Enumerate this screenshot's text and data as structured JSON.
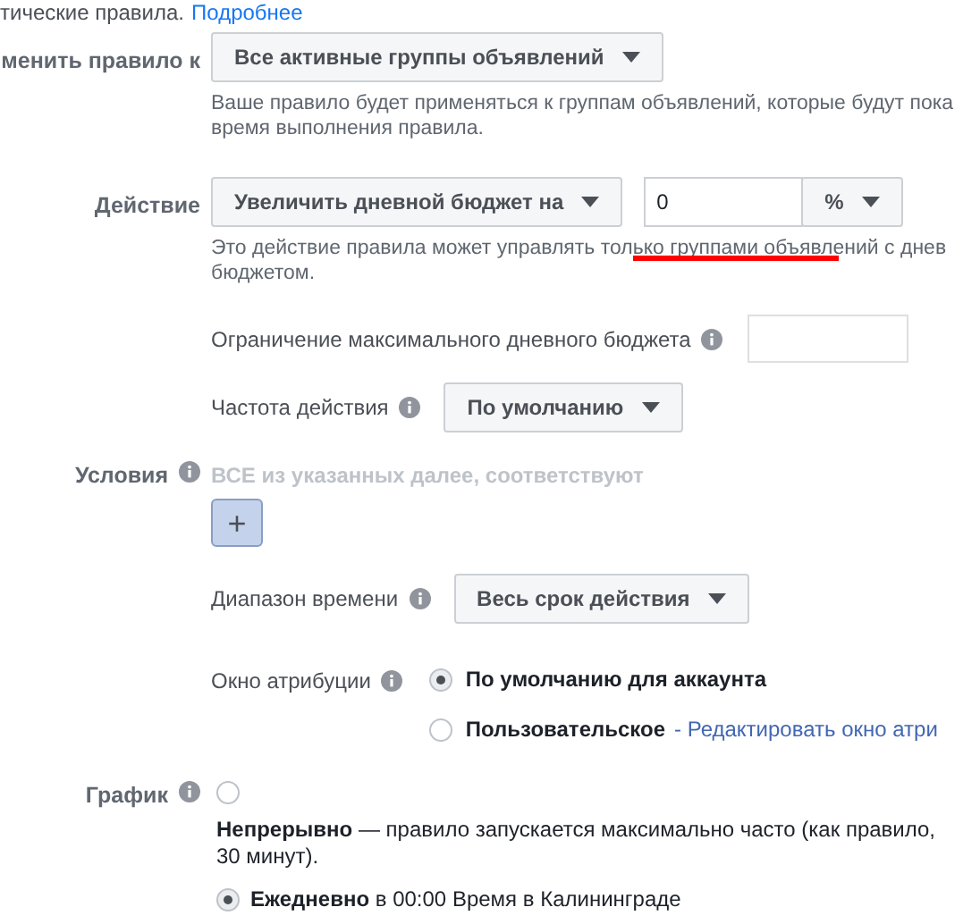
{
  "intro": {
    "text": "тические правила.",
    "link": "Подробнее"
  },
  "apply_to": {
    "label": "менить правило к",
    "select": "Все активные группы объявлений",
    "help_lines": [
      "Ваше правило будет применяться к группам объявлений, которые будут пока",
      "время выполнения правила."
    ]
  },
  "action": {
    "label": "Действие",
    "select": "Увеличить дневной бюджет на",
    "value": "0",
    "unit": "%",
    "help_lines": [
      "Это действие правила может управлять только группами объявлений с днев",
      "бюджетом."
    ]
  },
  "max_budget": {
    "label": "Ограничение максимального дневного бюджета"
  },
  "frequency": {
    "label": "Частота действия",
    "select": "По умолчанию"
  },
  "conditions": {
    "label": "Условия",
    "hint": "ВСЕ из указанных далее, соответствуют",
    "add_button": "+"
  },
  "time_range": {
    "label": "Диапазон времени",
    "select": "Весь срок действия"
  },
  "attribution": {
    "label": "Окно атрибуции",
    "options": [
      {
        "label": "По умолчанию для аккаунта",
        "selected": true
      },
      {
        "label": "Пользовательское",
        "link": "- Редактировать окно атри",
        "selected": false
      }
    ]
  },
  "schedule": {
    "label": "График",
    "options": [
      {
        "kind": "block",
        "selected": false,
        "lines": [
          "**Непрерывно** — правило запускается максимально часто (как правило,",
          "30 минут)."
        ]
      },
      {
        "kind": "inline",
        "selected": true,
        "lines": [
          "**Ежедневно** в 00:00 Время в Калининграде"
        ]
      }
    ]
  }
}
